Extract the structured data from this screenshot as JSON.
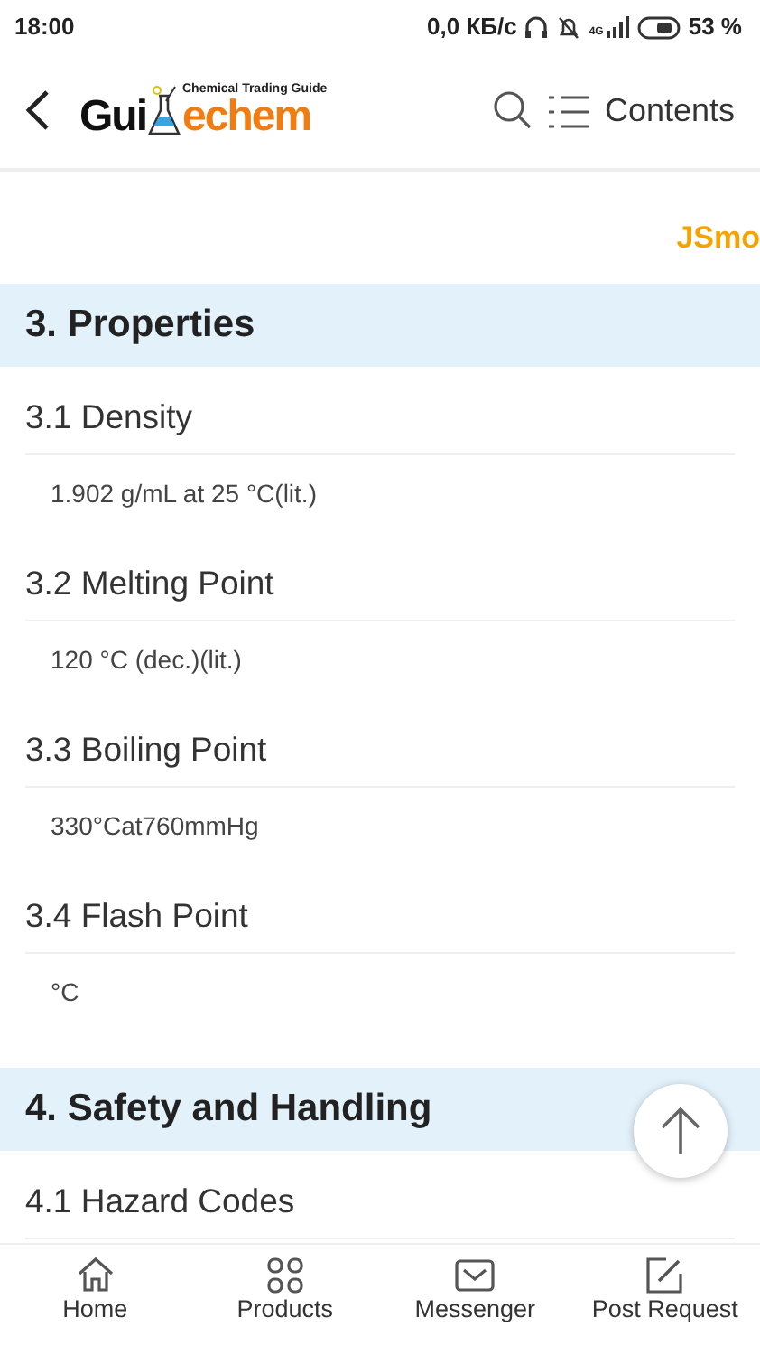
{
  "status_bar": {
    "time": "18:00",
    "speed": "0,0 КБ/с",
    "network": "4G",
    "battery_percent": "53 %"
  },
  "header": {
    "logo": {
      "part_1": "Gui",
      "part_2": "echem",
      "tagline": "Chemical Trading Guide"
    },
    "contents": "Contents"
  },
  "jsmol_link": "JSmo",
  "sections": [
    {
      "title": "3. Properties",
      "items": [
        {
          "title": "3.1 Density",
          "value": "1.902 g/mL at 25 °C(lit.)"
        },
        {
          "title": "3.2 Melting Point",
          "value": "120 °C (dec.)(lit.)"
        },
        {
          "title": "3.3 Boiling Point",
          "value": "330°Cat760mmHg"
        },
        {
          "title": "3.4 Flash Point",
          "value": "°C"
        }
      ]
    },
    {
      "title": "4. Safety and Handling",
      "items": [
        {
          "title": "4.1 Hazard Codes"
        }
      ]
    }
  ],
  "bottom_nav": [
    {
      "label": "Home"
    },
    {
      "label": "Products"
    },
    {
      "label": "Messenger"
    },
    {
      "label": "Post Request"
    }
  ]
}
